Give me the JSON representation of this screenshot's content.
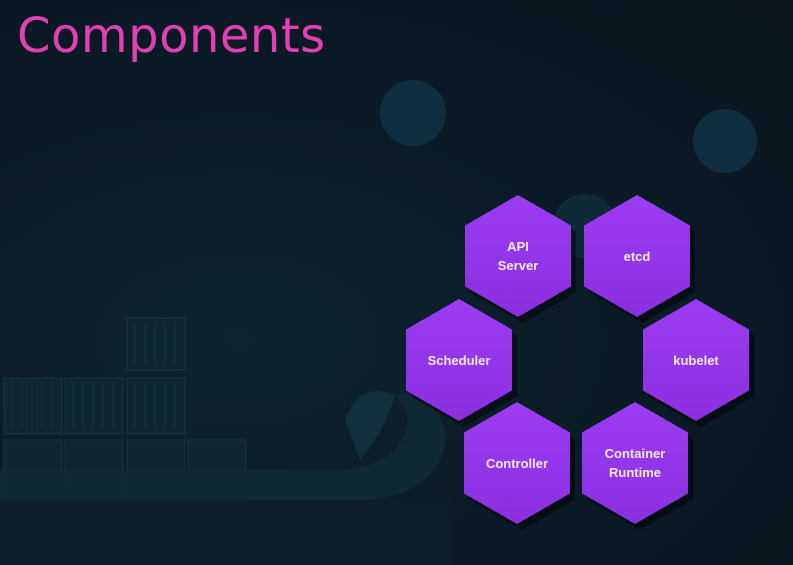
{
  "slide": {
    "title": "Components"
  },
  "components": [
    {
      "id": "api-server",
      "label": "API\nServer"
    },
    {
      "id": "etcd",
      "label": "etcd"
    },
    {
      "id": "scheduler",
      "label": "Scheduler"
    },
    {
      "id": "kubelet",
      "label": "kubelet"
    },
    {
      "id": "controller",
      "label": "Controller"
    },
    {
      "id": "container-runtime",
      "label": "Container\nRuntime"
    }
  ],
  "colors": {
    "title": "#e23fb4",
    "hexagon": "#9d3cf2",
    "background": "#0b1b28"
  }
}
